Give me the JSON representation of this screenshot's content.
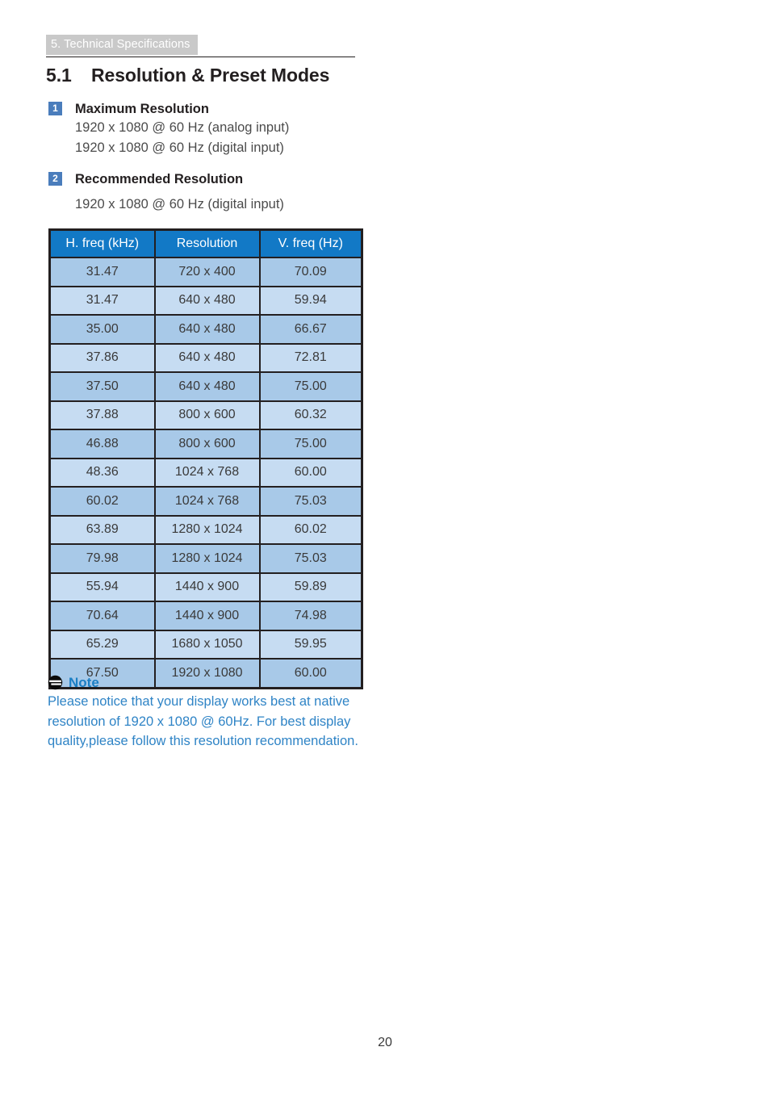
{
  "running_head": {
    "tab_label": "5. Technical Specifications"
  },
  "heading": {
    "number": "5.1",
    "title": "Resolution & Preset Modes"
  },
  "items": [
    {
      "badge": "1",
      "title": "Maximum Resolution",
      "lines": [
        "1920 x 1080 @ 60 Hz (analog input)",
        "1920 x 1080 @ 60 Hz (digital input)"
      ]
    },
    {
      "badge": "2",
      "title": "Recommended Resolution",
      "lines": [
        "1920 x 1080 @ 60 Hz (digital input)"
      ]
    }
  ],
  "table": {
    "headers": [
      "H. freq (kHz)",
      "Resolution",
      "V. freq (Hz)"
    ],
    "rows": [
      [
        "31.47",
        "720 x 400",
        "70.09"
      ],
      [
        "31.47",
        "640 x 480",
        "59.94"
      ],
      [
        "35.00",
        "640 x 480",
        "66.67"
      ],
      [
        "37.86",
        "640 x 480",
        "72.81"
      ],
      [
        "37.50",
        "640 x 480",
        "75.00"
      ],
      [
        "37.88",
        "800 x 600",
        "60.32"
      ],
      [
        "46.88",
        "800 x 600",
        "75.00"
      ],
      [
        "48.36",
        "1024 x 768",
        "60.00"
      ],
      [
        "60.02",
        "1024 x 768",
        "75.03"
      ],
      [
        "63.89",
        "1280 x 1024",
        "60.02"
      ],
      [
        "79.98",
        "1280 x 1024",
        "75.03"
      ],
      [
        "55.94",
        "1440 x 900",
        "59.89"
      ],
      [
        "70.64",
        "1440 x 900",
        "74.98"
      ],
      [
        "65.29",
        "1680 x 1050",
        "59.95"
      ],
      [
        "67.50",
        "1920 x 1080",
        "60.00"
      ]
    ]
  },
  "note": {
    "icon": "note-icon",
    "title": "Note",
    "body": "Please notice that your display works best at native resolution of 1920 x 1080 @ 60Hz. For best display quality,please follow this resolution recommendation."
  },
  "folio": {
    "page_number": "20"
  },
  "colors": {
    "tab_background": "#c9c9c9",
    "badge_blue": "#4a7dbc",
    "table_header_blue": "#1279c6",
    "row_dark_blue": "#a8c9e8",
    "row_light_blue": "#c6dcf2",
    "note_blue": "#2f84c6",
    "text_dark": "#231f20"
  }
}
